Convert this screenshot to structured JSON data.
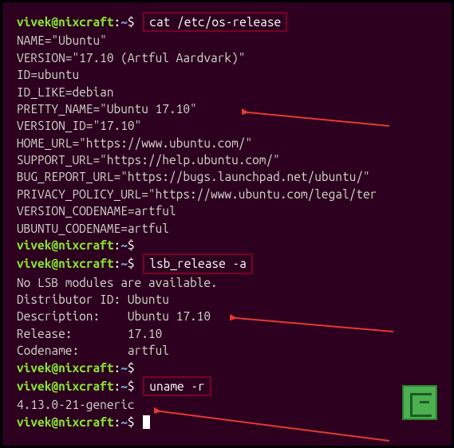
{
  "prompt": {
    "user": "vivek",
    "at": "@",
    "host": "nixcraft",
    "colon": ":",
    "path": "~",
    "dollar": "$"
  },
  "cmd1": "cat /etc/os-release",
  "out1": {
    "l1": "NAME=\"Ubuntu\"",
    "l2": "VERSION=\"17.10 (Artful Aardvark)\"",
    "l3": "ID=ubuntu",
    "l4": "ID_LIKE=debian",
    "l5": "PRETTY_NAME=\"Ubuntu 17.10\"",
    "l6": "VERSION_ID=\"17.10\"",
    "l7": "HOME_URL=\"https://www.ubuntu.com/\"",
    "l8": "SUPPORT_URL=\"https://help.ubuntu.com/\"",
    "l9": "BUG_REPORT_URL=\"https://bugs.launchpad.net/ubuntu/\"",
    "l10": "PRIVACY_POLICY_URL=\"https://www.ubuntu.com/legal/ter",
    "l11": "VERSION_CODENAME=artful",
    "l12": "UBUNTU_CODENAME=artful"
  },
  "cmd2": "lsb_release -a",
  "out2": {
    "l1": "No LSB modules are available.",
    "l2": "Distributor ID: Ubuntu",
    "l3": "Description:    Ubuntu 17.10",
    "l4": "Release:        17.10",
    "l5": "Codename:       artful"
  },
  "cmd3": "uname -r",
  "out3": {
    "l1": "4.13.0-21-generic"
  }
}
